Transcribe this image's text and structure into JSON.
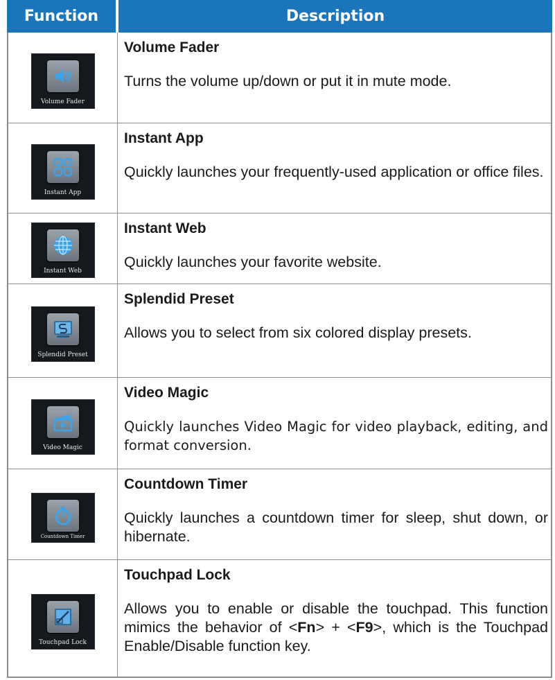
{
  "header": {
    "function": "Function",
    "description": "Description"
  },
  "colors": {
    "header_bg": "#1b75bb",
    "border": "#8c8c8c",
    "icon_bg": "#15181d",
    "icon_glyph": "#3aa3ea"
  },
  "rows": [
    {
      "icon": "speaker-icon",
      "icon_caption": "Volume Fader",
      "title": "Volume Fader",
      "description": "Turns the volume up/down or put it in mute mode."
    },
    {
      "icon": "apps-grid-icon",
      "icon_caption": "Instant App",
      "title": "Instant App",
      "description": "Quickly launches your frequently-used application or office files."
    },
    {
      "icon": "globe-icon",
      "icon_caption": "Instant Web",
      "title": "Instant Web",
      "description": "Quickly launches your favorite website."
    },
    {
      "icon": "display-preset-icon",
      "icon_caption": "Splendid Preset",
      "title": "Splendid Preset",
      "description": "Allows you to select from six colored display presets."
    },
    {
      "icon": "clapperboard-icon",
      "icon_caption": "Video Magic",
      "title": "Video Magic",
      "description": "Quickly launches Video Magic for video playback, editing, and format conversion."
    },
    {
      "icon": "timer-icon",
      "icon_caption": "Countdown Timer",
      "title": "Countdown Timer",
      "description": "Quickly launches a countdown timer for sleep, shut down, or hibernate."
    },
    {
      "icon": "touchpad-icon",
      "icon_caption": "Touchpad Lock",
      "title": "Touchpad Lock",
      "description_parts": [
        "Allows you to enable or disable the touchpad. This function mimics the behavior of <",
        "Fn",
        "> + <",
        "F9",
        ">, which is the Touchpad Enable/Disable function key."
      ]
    }
  ]
}
